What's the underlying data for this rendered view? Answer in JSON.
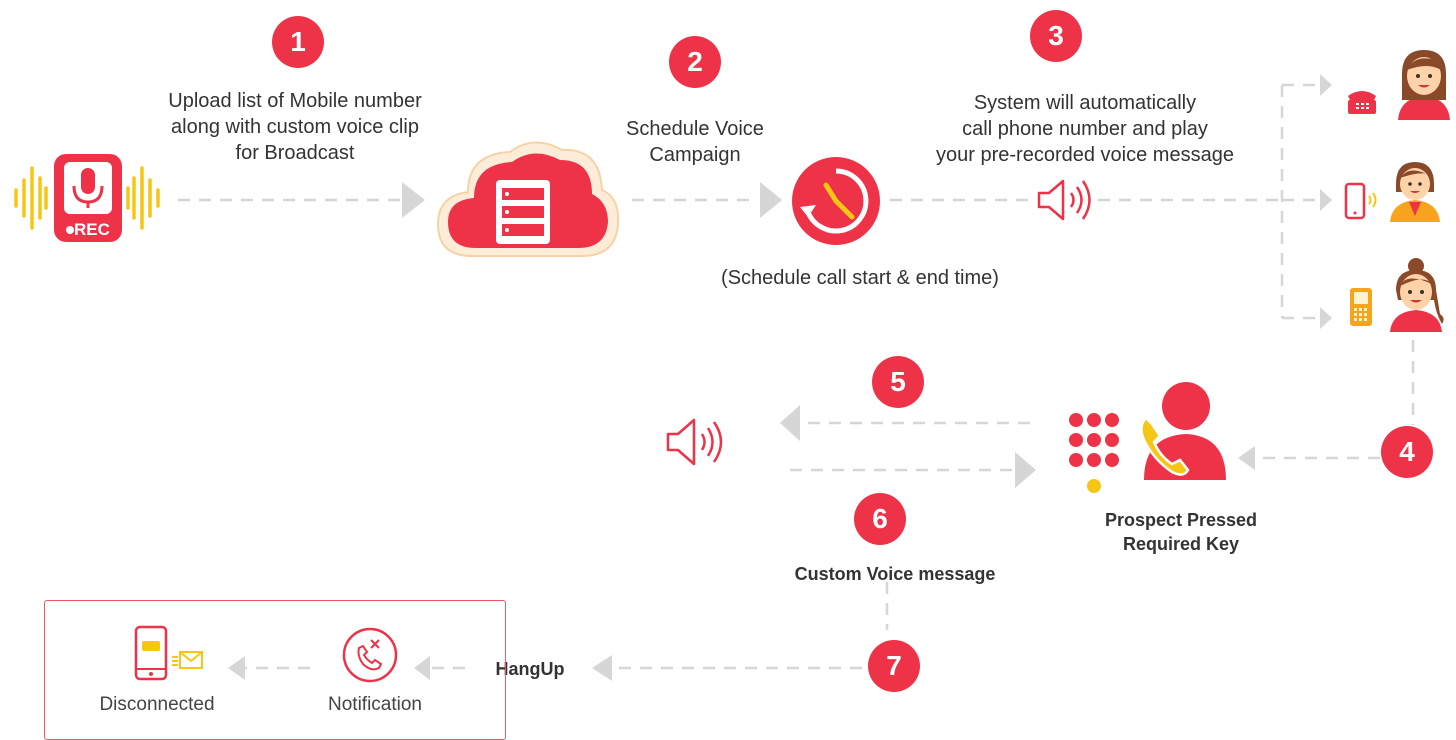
{
  "steps": [
    {
      "number": "1",
      "text_lines": [
        "Upload list of Mobile number",
        "along with custom voice clip",
        "for Broadcast"
      ]
    },
    {
      "number": "2",
      "text_lines": [
        "Schedule Voice",
        "Campaign"
      ]
    },
    {
      "number": "3",
      "text_lines": [
        "System will automatically",
        "call phone number and play",
        "your pre-recorded voice message"
      ]
    },
    {
      "number": "4"
    },
    {
      "number": "5"
    },
    {
      "number": "6",
      "text": "Custom Voice message"
    },
    {
      "number": "7"
    }
  ],
  "rec_icon_label": "REC",
  "schedule_note": "(Schedule call start & end time)",
  "prospect_lines": [
    "Prospect Pressed",
    "Required Key"
  ],
  "hangup_label": "HangUp",
  "notification_label": "Notification",
  "disconnected_label": "Disconnected",
  "colors": {
    "accent": "#ee3348",
    "yellow": "#f7c615",
    "line": "#d4d4d4",
    "skin": "#ffd2a8"
  }
}
